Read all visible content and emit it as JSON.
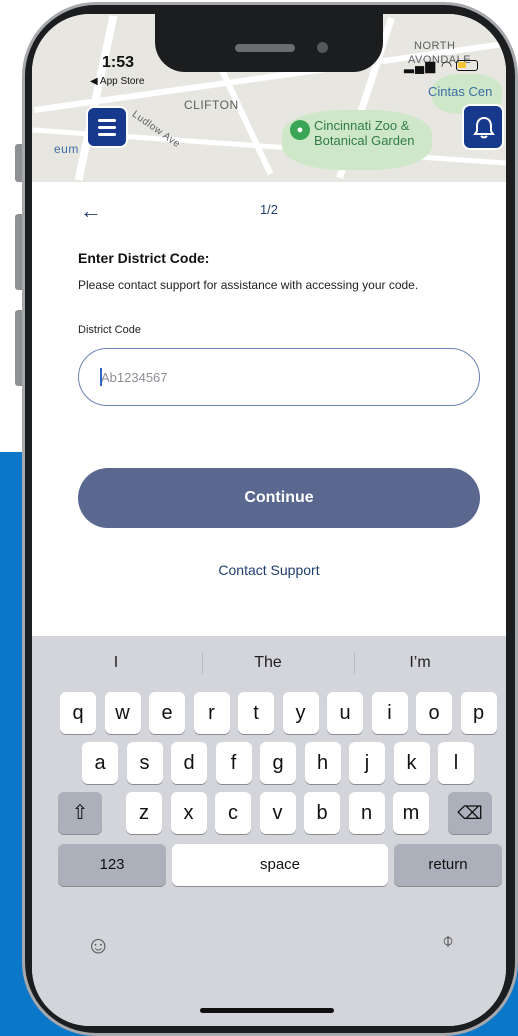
{
  "status_bar": {
    "time": "1:53",
    "back_label": "◀ App Store"
  },
  "map": {
    "area_label": "CLIFTON",
    "street_label": "Ludlow Ave",
    "zoo_label_line1": "Cincinnati Zoo &",
    "zoo_label_line2": "Botanical Garden",
    "top_right_label1": "NORTH",
    "top_right_label2": "AVONDALE",
    "cintas_label": "Cintas Cen",
    "left_label": "eum"
  },
  "header": {
    "back_icon": "←",
    "step": "1/2"
  },
  "form": {
    "heading": "Enter District Code:",
    "subtitle": "Please contact support for assistance with accessing your code.",
    "field_label": "District Code",
    "input_placeholder": "Ab1234567",
    "input_value": "",
    "continue_label": "Continue",
    "support_label": "Contact Support"
  },
  "keyboard": {
    "suggestions": [
      "I",
      "The",
      "I’m"
    ],
    "row1": [
      "q",
      "w",
      "e",
      "r",
      "t",
      "y",
      "u",
      "i",
      "o",
      "p"
    ],
    "row2": [
      "a",
      "s",
      "d",
      "f",
      "g",
      "h",
      "j",
      "k",
      "l"
    ],
    "row3": [
      "z",
      "x",
      "c",
      "v",
      "b",
      "n",
      "m"
    ],
    "shift": "⇧",
    "delete": "⌫",
    "numbers": "123",
    "space": "space",
    "return": "return",
    "emoji": "☺",
    "mic": "🎙"
  },
  "colors": {
    "primary": "#16388d",
    "button": "#5a6890",
    "link": "#1f3e6e",
    "background_blue": "#0b77c8"
  },
  "icons": {
    "menu": "hamburger-menu-icon",
    "notifications": "bell-icon",
    "back": "back-arrow-icon",
    "zoo": "paw-icon"
  }
}
